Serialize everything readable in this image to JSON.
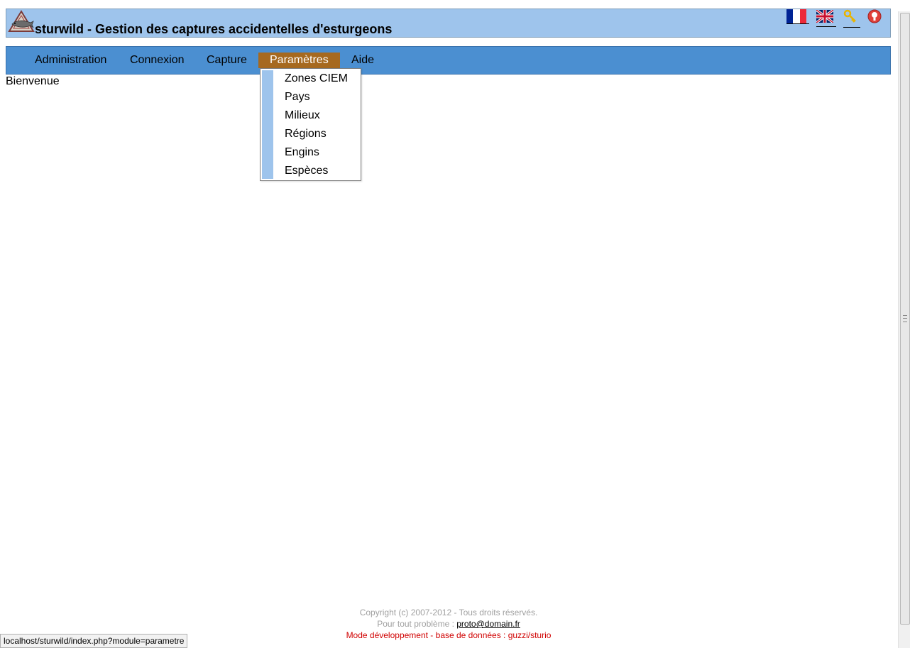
{
  "header": {
    "title": "sturwild - Gestion des captures accidentelles d'esturgeons",
    "logo_icon": "sturgeon-logo-icon",
    "lang_fr_icon": "french-flag-icon",
    "lang_en_icon": "uk-flag-icon",
    "login_icon": "key-icon",
    "help_icon": "help-icon",
    "background_color": "#9ec4ec"
  },
  "menu": {
    "background_color": "#4b8fd1",
    "active_color": "#a6691f",
    "items": [
      {
        "label": "Administration"
      },
      {
        "label": "Connexion"
      },
      {
        "label": "Capture"
      },
      {
        "label": "Paramètres",
        "active": true
      },
      {
        "label": "Aide"
      }
    ]
  },
  "dropdown": {
    "items": [
      {
        "label": "Zones CIEM"
      },
      {
        "label": "Pays"
      },
      {
        "label": "Milieux"
      },
      {
        "label": "Régions"
      },
      {
        "label": "Engins"
      },
      {
        "label": "Espèces"
      }
    ]
  },
  "main": {
    "welcome": "Bienvenue"
  },
  "footer": {
    "copyright": "Copyright (c) 2007-2012 - Tous droits réservés.",
    "support_prefix": "Pour tout problème : ",
    "support_email": "proto@domain.fr",
    "devmode": "Mode développement - base de données : guzzi/sturio"
  },
  "statusbar": {
    "url": "localhost/sturwild/index.php?module=parametre"
  }
}
